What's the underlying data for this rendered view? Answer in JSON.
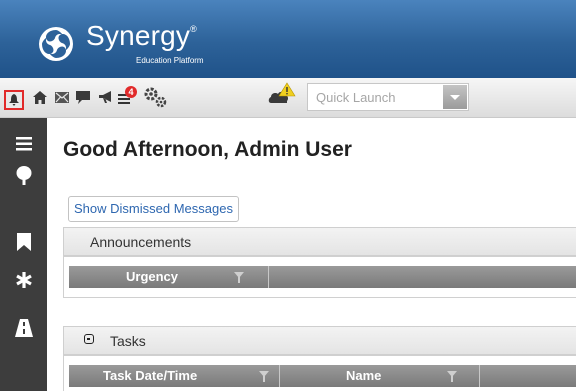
{
  "app": {
    "brand_name": "Synergy",
    "brand_mark": "®",
    "tagline": "Education Platform"
  },
  "toolbar": {
    "icons": [
      "notifications-icon",
      "home-icon",
      "mail-icon",
      "chat-icon",
      "megaphone-icon",
      "tasks-icon",
      "settings-icon",
      "cloud-warning-icon"
    ],
    "badge_color": "#e12a2a",
    "quick_launch_placeholder": "Quick Launch"
  },
  "sidebar": {
    "icons": [
      "menu-icon",
      "tree-icon",
      "bookmark-icon",
      "asterisk-icon",
      "road-icon"
    ]
  },
  "main": {
    "greeting": "Good Afternoon, Admin User",
    "show_dismissed_label": "Show Dismissed Messages",
    "announcements": {
      "title": "Announcements",
      "columns": [
        "Urgency"
      ]
    },
    "tasks": {
      "title": "Tasks",
      "columns": [
        "Task Date/Time",
        "Name"
      ]
    }
  },
  "colors": {
    "header": "#2d6299",
    "sidebar": "#3d3d3d",
    "link": "#2e67b0",
    "grid_header": "#8a8a8a",
    "highlight": "#e12a2a"
  }
}
